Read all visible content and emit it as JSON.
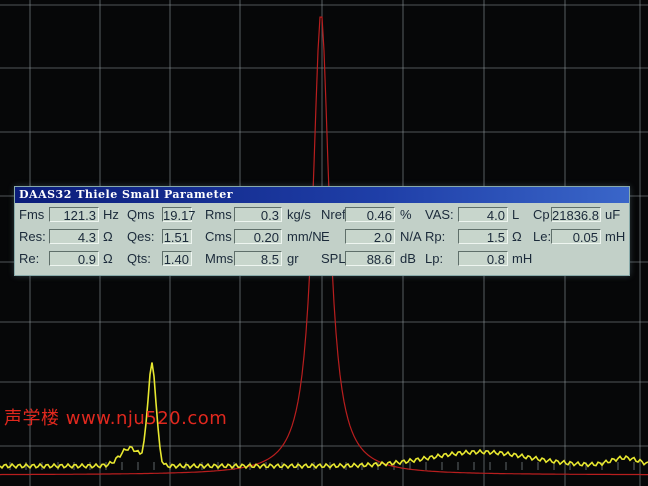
{
  "window": {
    "title": "DAAS32 Thiele Small Parameter"
  },
  "rows": [
    [
      {
        "label": "Fms",
        "value": "121.3",
        "unit": "Hz"
      },
      {
        "label": "Qms",
        "value": "19.17",
        "unit": ""
      },
      {
        "label": "Rms",
        "value": "0.3",
        "unit": "kg/s"
      },
      {
        "label": "Nref",
        "value": "0.46",
        "unit": "%"
      },
      {
        "label": "VAS:",
        "value": "4.0",
        "unit": "L"
      },
      {
        "label": "Cp",
        "value": "21836.8",
        "unit": "uF"
      }
    ],
    [
      {
        "label": "Res:",
        "value": "4.3",
        "unit": "Ω"
      },
      {
        "label": "Qes:",
        "value": "1.51",
        "unit": ""
      },
      {
        "label": "Cms",
        "value": "0.20",
        "unit": "mm/N"
      },
      {
        "label": "E",
        "value": "2.0",
        "unit": "N/A"
      },
      {
        "label": "Rp:",
        "value": "1.5",
        "unit": "Ω"
      },
      {
        "label": "Le:",
        "value": "0.05",
        "unit": "mH"
      }
    ],
    [
      {
        "label": "Re:",
        "value": "0.9",
        "unit": "Ω"
      },
      {
        "label": "Qts:",
        "value": "1.40",
        "unit": ""
      },
      {
        "label": "Mms",
        "value": "8.5",
        "unit": "gr"
      },
      {
        "label": "SPL",
        "value": "88.6",
        "unit": "dB"
      },
      {
        "label": "Lp:",
        "value": "0.8",
        "unit": "mH"
      }
    ]
  ],
  "watermark": "声学楼 www.nju520.com",
  "colors": {
    "grid": "#9aa3a8",
    "impedance_trace": "#b81e1e",
    "response_trace": "#e8e830",
    "panel": "#c2d0c8",
    "titlebar": "#1f3fa8"
  }
}
